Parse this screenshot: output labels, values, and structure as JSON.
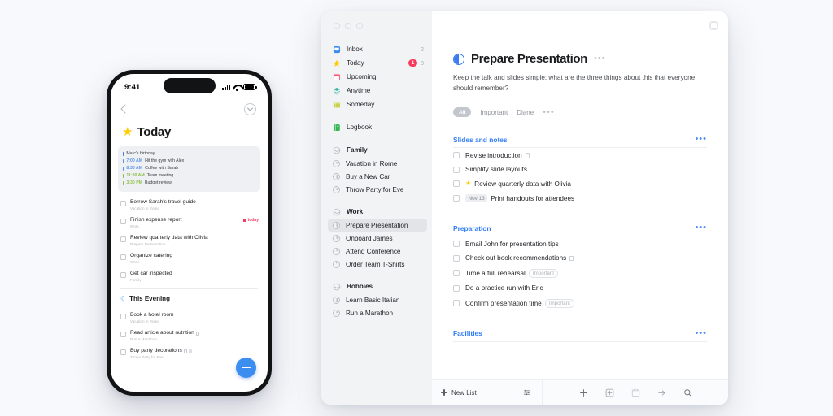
{
  "phone": {
    "status": {
      "time": "9:41",
      "signal_icon": "cellular-signal-icon",
      "wifi_icon": "wifi-icon",
      "battery_icon": "battery-icon"
    },
    "nav": {
      "back_icon": "back-chevron-icon",
      "menu_icon": "chevron-down-circle-icon"
    },
    "header": {
      "icon": "star-icon",
      "title": "Today"
    },
    "calendar": [
      {
        "time": "",
        "text": "Marc's birthday",
        "color": "#4a7fe0"
      },
      {
        "time": "7:00 AM",
        "text": "Hit the gym with Alex",
        "color": "#5b93e8"
      },
      {
        "time": "8:30 AM",
        "text": "Coffee with Sarah",
        "color": "#5b93e8"
      },
      {
        "time": "11:00 AM",
        "text": "Team meeting",
        "color": "#8fbf4a"
      },
      {
        "time": "3:30 PM",
        "text": "Budget review",
        "color": "#8fbf4a"
      }
    ],
    "today_items": [
      {
        "title": "Borrow Sarah's travel guide",
        "sub": "Vacation in Rome",
        "flag": "",
        "notes": false,
        "tags": 0
      },
      {
        "title": "Finish expense report",
        "sub": "Work",
        "flag": "today",
        "notes": false,
        "tags": 0
      },
      {
        "title": "Review quarterly data with Olivia",
        "sub": "Prepare Presentation",
        "flag": "",
        "notes": false,
        "tags": 0
      },
      {
        "title": "Organize catering",
        "sub": "Work",
        "flag": "",
        "notes": false,
        "tags": 0
      },
      {
        "title": "Get car inspected",
        "sub": "Family",
        "flag": "",
        "notes": false,
        "tags": 0
      }
    ],
    "evening": {
      "icon": "moon-icon",
      "title": "This Evening"
    },
    "evening_items": [
      {
        "title": "Book a hotel room",
        "sub": "Vacation in Rome",
        "notes": false,
        "tags": 0
      },
      {
        "title": "Read article about nutrition",
        "sub": "Run a Marathon",
        "notes": true,
        "tags": 0
      },
      {
        "title": "Buy party decorations",
        "sub": "Throw Party for Eve",
        "notes": true,
        "tags": 1
      }
    ],
    "fab": {
      "name": "add-task-button",
      "icon": "plus-icon"
    }
  },
  "desktop": {
    "window_controls": [
      "close",
      "minimize",
      "zoom"
    ],
    "corner_icon": "window-layout-icon",
    "sidebar": {
      "smart_lists": [
        {
          "label": "Inbox",
          "icon": "inbox-icon",
          "color": "#3b8df0",
          "count": "2",
          "badge": ""
        },
        {
          "label": "Today",
          "icon": "star-icon",
          "color": "#ffcc00",
          "count": "8",
          "badge": "1"
        },
        {
          "label": "Upcoming",
          "icon": "calendar-icon",
          "color": "#fa5a7a",
          "count": "",
          "badge": ""
        },
        {
          "label": "Anytime",
          "icon": "layers-icon",
          "color": "#2eb8a0",
          "count": "",
          "badge": ""
        },
        {
          "label": "Someday",
          "icon": "box-icon",
          "color": "#c9d14e",
          "count": "",
          "badge": ""
        }
      ],
      "logbook": {
        "label": "Logbook",
        "icon": "book-icon",
        "color": "#34b855"
      },
      "areas": [
        {
          "name": "Family",
          "icon": "area-icon",
          "projects": [
            {
              "label": "Vacation in Rome",
              "progress": 90
            },
            {
              "label": "Buy a New Car",
              "progress": 180
            },
            {
              "label": "Throw Party for Eve",
              "progress": 120
            }
          ]
        },
        {
          "name": "Work",
          "icon": "area-icon",
          "projects": [
            {
              "label": "Prepare Presentation",
              "progress": 170,
              "selected": true
            },
            {
              "label": "Onboard James",
              "progress": 110
            },
            {
              "label": "Attend Conference",
              "progress": 50
            },
            {
              "label": "Order Team T-Shirts",
              "progress": 30
            }
          ]
        },
        {
          "name": "Hobbies",
          "icon": "area-icon",
          "projects": [
            {
              "label": "Learn Basic Italian",
              "progress": 200
            },
            {
              "label": "Run a Marathon",
              "progress": 60
            }
          ]
        }
      ]
    },
    "task": {
      "icon": "half-filled-circle-icon",
      "title": "Prepare Presentation",
      "more_icon": "ellipsis-icon",
      "note": "Keep the talk and slides simple: what are the three things about this that everyone should remember?",
      "tags": [
        {
          "label": "All",
          "selected": true
        },
        {
          "label": "Important",
          "selected": false
        },
        {
          "label": "Diane",
          "selected": false
        }
      ],
      "tags_more_icon": "ellipsis-icon"
    },
    "sections": [
      {
        "heading": "Slides and notes",
        "more_icon": "ellipsis-icon",
        "items": [
          {
            "label": "Revise introduction",
            "star": false,
            "date": "",
            "badge": "",
            "notes": true
          },
          {
            "label": "Simplify slide layouts",
            "star": false,
            "date": "",
            "badge": "",
            "notes": false
          },
          {
            "label": "Review quarterly data with Olivia",
            "star": true,
            "date": "",
            "badge": "",
            "notes": false
          },
          {
            "label": "Print handouts for attendees",
            "star": false,
            "date": "Nov 13",
            "badge": "",
            "notes": false
          }
        ]
      },
      {
        "heading": "Preparation",
        "more_icon": "ellipsis-icon",
        "items": [
          {
            "label": "Email John for presentation tips",
            "star": false,
            "date": "",
            "badge": "",
            "notes": false
          },
          {
            "label": "Check out book recommendations",
            "star": false,
            "date": "",
            "badge": "",
            "notes": true
          },
          {
            "label": "Time a full rehearsal",
            "star": false,
            "date": "",
            "badge": "Important",
            "notes": false
          },
          {
            "label": "Do a practice run with Eric",
            "star": false,
            "date": "",
            "badge": "",
            "notes": false
          },
          {
            "label": "Confirm presentation time",
            "star": false,
            "date": "",
            "badge": "Important",
            "notes": false
          }
        ]
      },
      {
        "heading": "Facilities",
        "more_icon": "ellipsis-icon",
        "items": []
      }
    ],
    "toolbar": {
      "new_list_label": "New List",
      "new_list_icon": "plus-icon",
      "filter_icon": "sliders-icon",
      "actions": [
        {
          "name": "add-todo-button",
          "icon": "plus-icon"
        },
        {
          "name": "add-heading-button",
          "icon": "plus-in-box-icon"
        },
        {
          "name": "when-calendar-button",
          "icon": "calendar-icon"
        },
        {
          "name": "move-button",
          "icon": "arrow-right-icon"
        },
        {
          "name": "search-button",
          "icon": "magnifier-icon"
        }
      ]
    }
  }
}
